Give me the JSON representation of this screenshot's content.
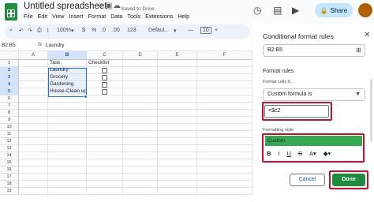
{
  "app": {
    "doc_title": "Untitled spreadsheet",
    "saved_status": "Saved to Drive",
    "menu": [
      "File",
      "Edit",
      "View",
      "Insert",
      "Format",
      "Data",
      "Tools",
      "Extensions",
      "Help"
    ],
    "share_label": "Share"
  },
  "toolbar": {
    "zoom": "100%",
    "currency": "$",
    "percent": "%",
    "decimal_dec": ".0",
    "decimal_inc": ".00",
    "number_format": "123",
    "font": "Defaul...",
    "minus": "—",
    "font_size": "10",
    "plus": "+"
  },
  "formula_bar": {
    "name_box": "B2:B5",
    "fx": "fx",
    "value": "Laundry"
  },
  "grid": {
    "columns": [
      "A",
      "B",
      "C",
      "D",
      "E",
      "F"
    ],
    "rows": [
      "1",
      "2",
      "3",
      "4",
      "5",
      "6",
      "7",
      "8",
      "9",
      "10",
      "11",
      "12",
      "13",
      "14",
      "15",
      "16",
      "17",
      "18",
      "19"
    ],
    "b_values": [
      "Task",
      "Laundry",
      "Grocery",
      "Gardening",
      "House-Clean up"
    ],
    "c_header": "Checklist"
  },
  "panel": {
    "title": "Conditional format rules",
    "range": "B2:B5",
    "format_rules_label": "Format rules",
    "format_cells_if_label": "Format cells if...",
    "condition": "Custom formula is",
    "formula": "=$c2",
    "formatting_style_label": "Formatting style",
    "style_name": "Custom",
    "cancel_label": "Cancel",
    "done_label": "Done"
  },
  "colors": {
    "accent": "#1a73e8",
    "done_green": "#1e8e3e",
    "preview_green": "#34a853",
    "highlight_red": "#c8102e",
    "share_bg": "#c2e7ff"
  },
  "icons": [
    "sheets-logo",
    "star-icon",
    "move-icon",
    "cloud-icon",
    "history-icon",
    "comment-icon",
    "meet-icon",
    "lock-icon",
    "search-icon",
    "undo-icon",
    "redo-icon",
    "print-icon",
    "paint-format-icon",
    "close-icon",
    "grid-select-icon",
    "chevron-down-icon",
    "bold-icon",
    "italic-icon",
    "underline-icon",
    "strikethrough-icon",
    "text-color-icon",
    "fill-color-icon"
  ]
}
